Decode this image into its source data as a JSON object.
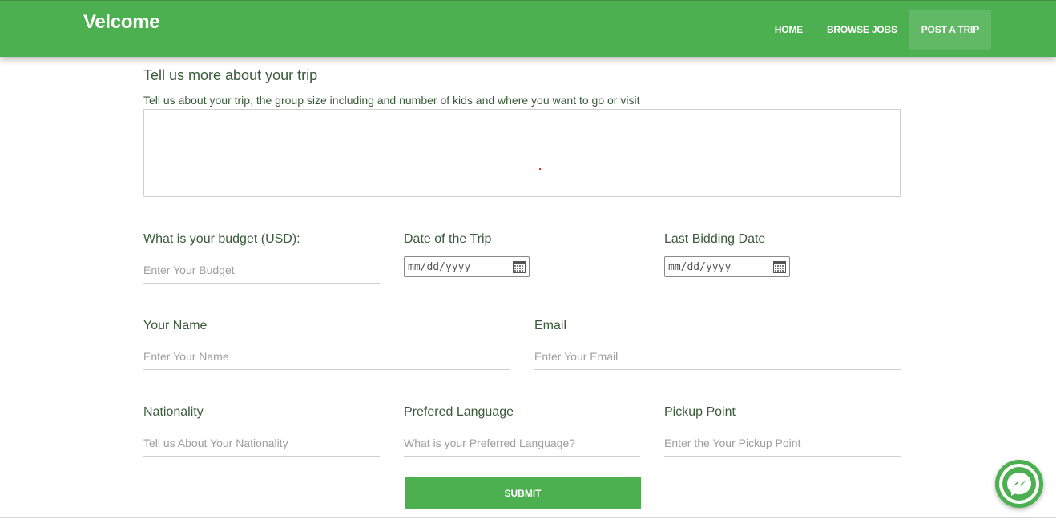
{
  "brand": "Velcome",
  "nav": {
    "items": [
      {
        "label": "HOME",
        "active": false
      },
      {
        "label": "BROWSE JOBS",
        "active": false
      },
      {
        "label": "POST A TRIP",
        "active": true
      }
    ]
  },
  "trip": {
    "title": "Tell us more about your trip",
    "help": "Tell us about your trip, the group size including and number of kids and where you want to go or visit",
    "value": ""
  },
  "budget": {
    "label": "What is your budget (USD):",
    "placeholder": "Enter Your Budget"
  },
  "trip_date": {
    "label": "Date of the Trip",
    "placeholder": "mm/dd/yyyy"
  },
  "last_bidding": {
    "label": "Last Bidding Date",
    "placeholder": "mm/dd/yyyy"
  },
  "name": {
    "label": "Your Name",
    "placeholder": "Enter Your Name"
  },
  "email": {
    "label": "Email",
    "placeholder": "Enter Your Email"
  },
  "nationality": {
    "label": "Nationality",
    "placeholder": "Tell us About Your Nationality"
  },
  "language": {
    "label": "Prefered Language",
    "placeholder": "What is your Preferred Language?"
  },
  "pickup": {
    "label": "Pickup Point",
    "placeholder": "Enter the Your Pickup Point"
  },
  "submit_label": "SUBMIT",
  "colors": {
    "primary": "#4caf50",
    "label": "#3a5a3a",
    "placeholder": "#9e9e9e"
  },
  "icons": {
    "calendar": "calendar-icon",
    "chat": "messenger-icon"
  }
}
